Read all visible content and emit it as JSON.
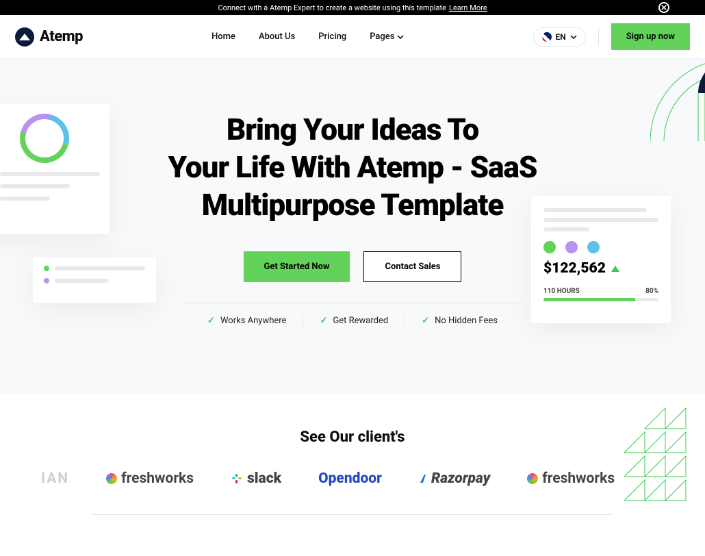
{
  "topbar": {
    "message": "Connect with a Atemp Expert to create a website using this template",
    "link_text": "Learn More"
  },
  "brand": {
    "name": "Atemp"
  },
  "nav": {
    "home": "Home",
    "about": "About Us",
    "pricing": "Pricing",
    "pages": "Pages"
  },
  "lang": {
    "code": "EN"
  },
  "header_cta": "Sign up now",
  "hero": {
    "title_l1": "Bring Your Ideas To",
    "title_l2": "Your Life With Atemp - SaaS",
    "title_l3": "Multipurpose Template",
    "cta_primary": "Get Started Now",
    "cta_secondary": "Contact Sales"
  },
  "features": {
    "f1": "Works Anywhere",
    "f2": "Get Rewarded",
    "f3": "No Hidden Fees"
  },
  "stat_card": {
    "amount": "$122,562",
    "hours_label": "110 HOURS",
    "percent": "80%"
  },
  "clients": {
    "heading": "See Our client's",
    "c0_suffix": "IAN",
    "c1": "freshworks",
    "c2": "slack",
    "c3": "Opendoor",
    "c4": "Razorpay",
    "c5": "freshworks"
  },
  "colors": {
    "accent": "#62d25a",
    "purple": "#b892f0",
    "blue": "#5ac1e8"
  }
}
